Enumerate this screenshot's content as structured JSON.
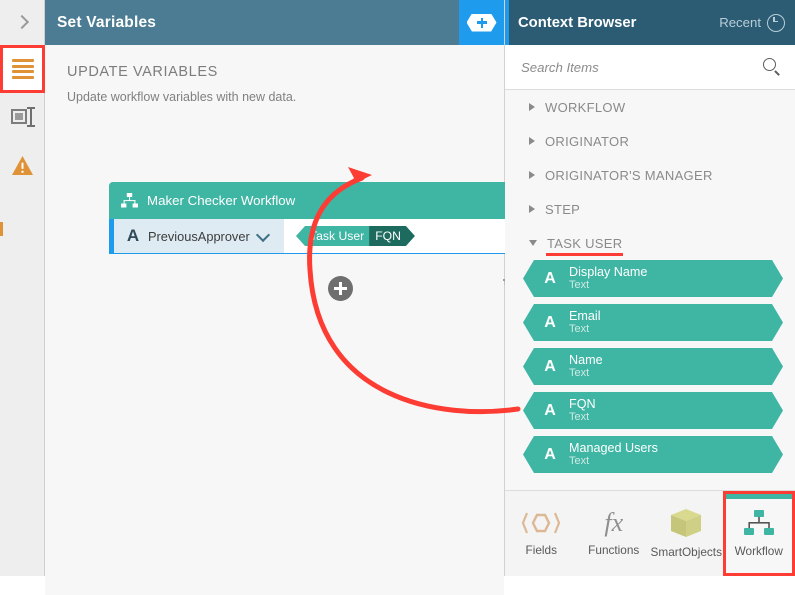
{
  "left_rail": {
    "collapse_icon": "chevron-right-icon",
    "items": [
      {
        "name": "list-icon",
        "highlighted": true
      },
      {
        "name": "rename-icon",
        "highlighted": false
      },
      {
        "name": "warning-icon",
        "highlighted": false
      }
    ]
  },
  "center": {
    "title": "Set Variables",
    "add_context_button_icon": "hex-plus-icon",
    "section_title": "UPDATE VARIABLES",
    "section_subtitle": "Update workflow variables with new data.",
    "card": {
      "header_icon": "workflow-icon",
      "header_label": "Maker Checker Workflow",
      "row": {
        "type_glyph": "A",
        "variable_name": "PreviousApprover",
        "dropdown_icon": "chevron-down-icon",
        "value_tag": {
          "context": "Task User",
          "property": "FQN"
        }
      }
    },
    "add_button_icon": "plus-circle-icon",
    "delete_button_icon": "trash-icon"
  },
  "right": {
    "title": "Context Browser",
    "recent_label": "Recent",
    "recent_icon": "clock-icon",
    "search": {
      "placeholder": "Search Items",
      "value": "",
      "icon": "search-icon"
    },
    "tree": [
      {
        "label": "WORKFLOW",
        "expanded": false
      },
      {
        "label": "ORIGINATOR",
        "expanded": false
      },
      {
        "label": "ORIGINATOR'S MANAGER",
        "expanded": false
      },
      {
        "label": "STEP",
        "expanded": false
      },
      {
        "label": "TASK USER",
        "expanded": true,
        "annotated": true
      }
    ],
    "fields": [
      {
        "glyph": "A",
        "name": "Display Name",
        "type": "Text"
      },
      {
        "glyph": "A",
        "name": "Email",
        "type": "Text"
      },
      {
        "glyph": "A",
        "name": "Name",
        "type": "Text"
      },
      {
        "glyph": "A",
        "name": "FQN",
        "type": "Text"
      },
      {
        "glyph": "A",
        "name": "Managed Users",
        "type": "Text"
      }
    ],
    "tools": [
      {
        "label": "Fields",
        "icon": "fields-icon",
        "active": false
      },
      {
        "label": "Functions",
        "icon": "function-icon",
        "active": false
      },
      {
        "label": "SmartObjects",
        "icon": "cube-icon",
        "active": false
      },
      {
        "label": "Workflow",
        "icon": "workflow-icon",
        "active": true
      }
    ]
  },
  "annotations": {
    "arrow_color": "#fd3c34",
    "highlight_color": "#fd3c34"
  },
  "colors": {
    "title_bar": "#4b7c93",
    "context_header": "#2b5c74",
    "accent_blue": "#1f9bed",
    "teal": "#3fb5a4",
    "teal_dark": "#1d6a5f",
    "orange": "#e09236"
  }
}
